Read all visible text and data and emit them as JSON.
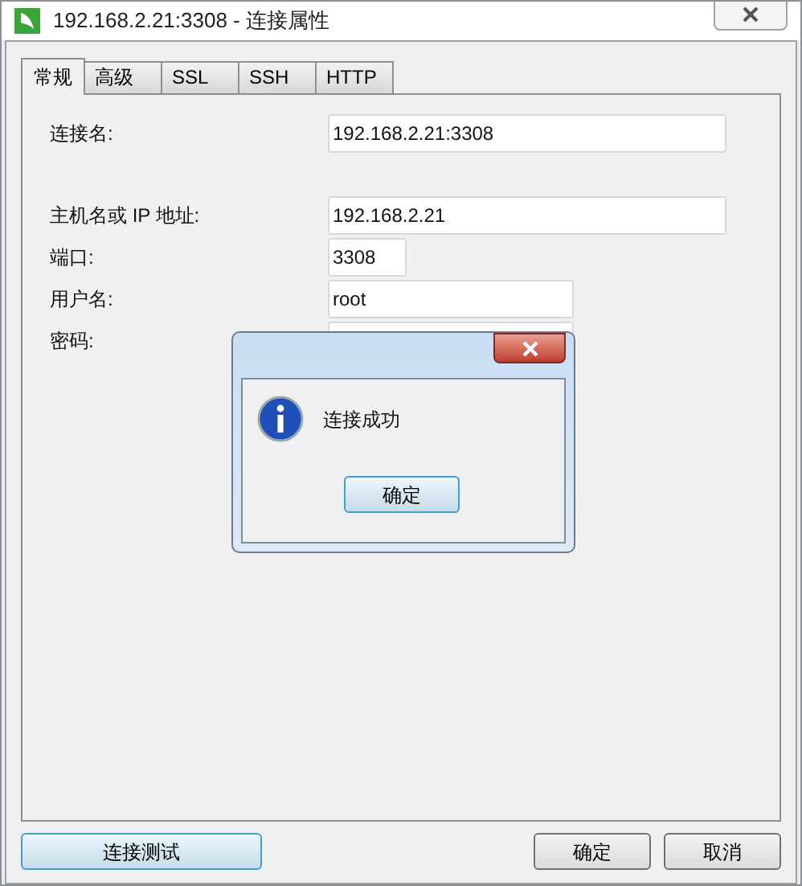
{
  "window": {
    "title": "192.168.2.21:3308 - 连接属性"
  },
  "tabs": [
    {
      "label": "常规",
      "selected": true
    },
    {
      "label": "高级",
      "selected": false
    },
    {
      "label": "SSL",
      "selected": false
    },
    {
      "label": "SSH",
      "selected": false
    },
    {
      "label": "HTTP",
      "selected": false
    }
  ],
  "fields": [
    {
      "label": "连接名:",
      "value": "192.168.2.21:3308"
    },
    {
      "label": "主机名或 IP 地址:",
      "value": "192.168.2.21"
    },
    {
      "label": "端口:",
      "value": "3308"
    },
    {
      "label": "用户名:",
      "value": "root"
    },
    {
      "label": "密码:"
    }
  ],
  "message_box": {
    "message": "连接成功",
    "button": "确定"
  },
  "buttons": {
    "test": "连接测试",
    "ok": "确定",
    "cancel": "取消"
  }
}
